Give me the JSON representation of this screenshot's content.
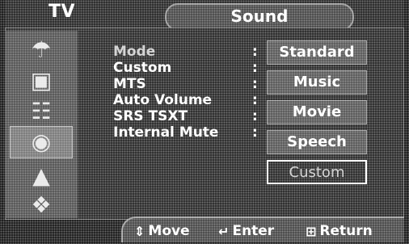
{
  "header": {
    "source_label": "TV",
    "menu_title": "Sound"
  },
  "sidebar": {
    "icons": [
      {
        "name": "input-icon"
      },
      {
        "name": "picture-icon"
      },
      {
        "name": "sound-icon"
      },
      {
        "name": "channel-icon"
      },
      {
        "name": "setup-icon"
      },
      {
        "name": "guide-icon"
      }
    ],
    "active_index": 2
  },
  "menu": {
    "items": [
      {
        "label": "Mode",
        "dim": true
      },
      {
        "label": "Custom",
        "dim": false
      },
      {
        "label": "MTS",
        "dim": false
      },
      {
        "label": "Auto Volume",
        "dim": false
      },
      {
        "label": "SRS TSXT",
        "dim": false
      },
      {
        "label": "Internal Mute",
        "dim": false
      }
    ],
    "separator": ":"
  },
  "mode_options": {
    "items": [
      "Standard",
      "Music",
      "Movie",
      "Speech",
      "Custom"
    ],
    "current": "Custom"
  },
  "nav": {
    "move": "Move",
    "enter": "Enter",
    "return": "Return"
  }
}
